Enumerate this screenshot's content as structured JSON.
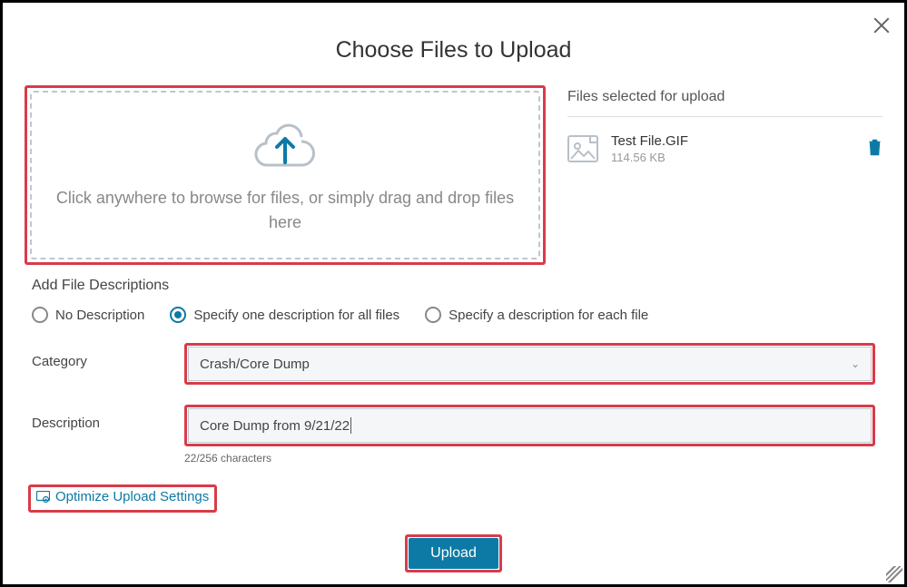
{
  "dialog": {
    "title": "Choose Files to Upload"
  },
  "dropzone": {
    "text": "Click anywhere to browse for files, or simply drag and drop files here"
  },
  "files": {
    "heading": "Files selected for upload",
    "items": [
      {
        "name": "Test File.GIF",
        "size": "114.56 KB"
      }
    ]
  },
  "descriptions": {
    "label": "Add File Descriptions",
    "options": [
      "No Description",
      "Specify one description for all files",
      "Specify a description for each file"
    ],
    "selected_index": 1
  },
  "category": {
    "label": "Category",
    "value": "Crash/Core Dump"
  },
  "description": {
    "label": "Description",
    "value": "Core Dump from 9/21/22",
    "counter": "22/256 characters"
  },
  "optimize": {
    "label": "Optimize Upload Settings"
  },
  "upload": {
    "label": "Upload"
  }
}
